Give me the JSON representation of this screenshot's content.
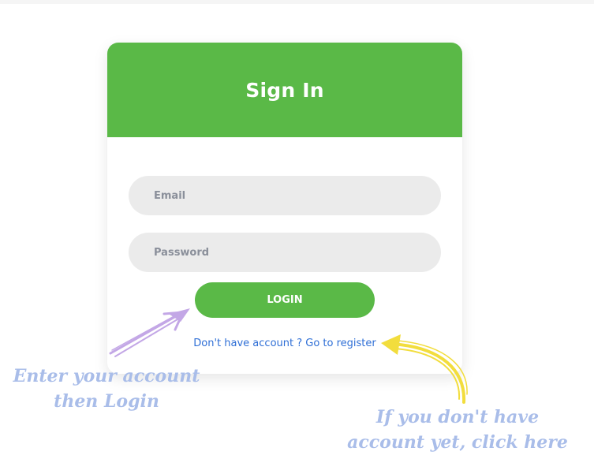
{
  "login_card": {
    "title": "Sign In",
    "email_placeholder": "Email",
    "password_placeholder": "Password",
    "login_label": "LOGIN",
    "register_link": "Don't have account ? Go to register"
  },
  "annotations": {
    "left_note": "Enter your account then Login",
    "right_note": "If you don't have account yet, click here",
    "left_arrow_color": "#c3a7e6",
    "right_arrow_color": "#f2dd3d"
  },
  "colors": {
    "accent": "#5ab947",
    "input_bg": "#ebebeb",
    "link": "#2f6fd6",
    "note_text": "#a9bde9"
  }
}
